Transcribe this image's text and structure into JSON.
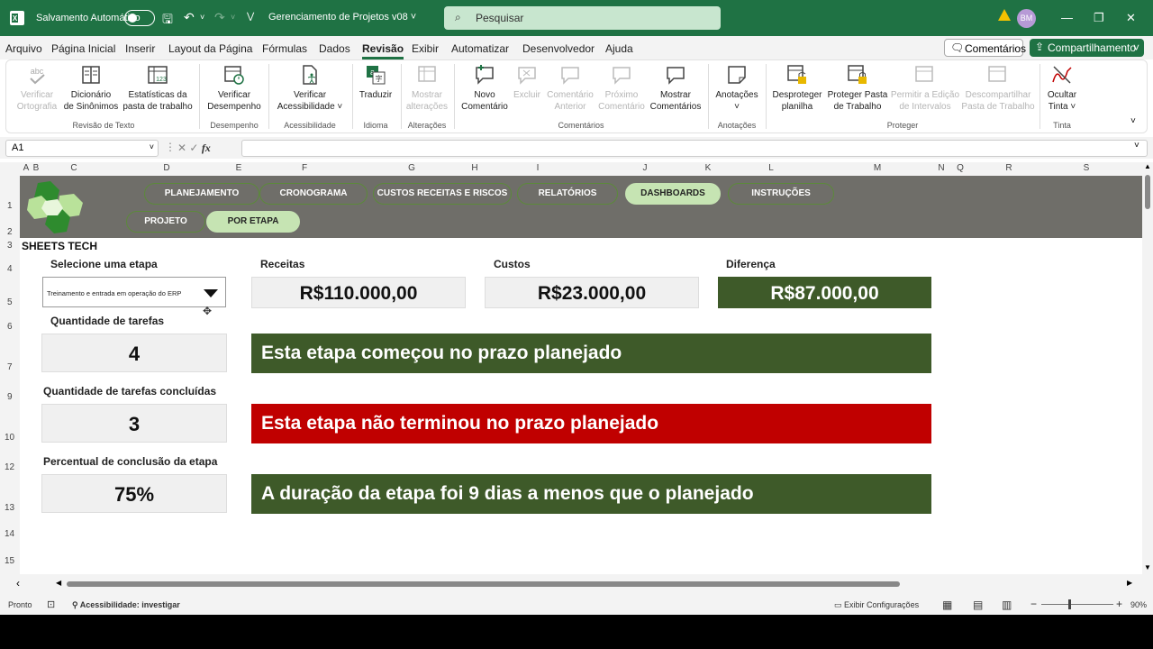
{
  "titlebar": {
    "autosave_label": "Salvamento Automático",
    "doc_title": "Gerenciamento de Projetos v08",
    "search_placeholder": "Pesquisar",
    "user_initials": "BM"
  },
  "menu": [
    "Arquivo",
    "Página Inicial",
    "Inserir",
    "Layout da Página",
    "Fórmulas",
    "Dados",
    "Revisão",
    "Exibir",
    "Automatizar",
    "Desenvolvedor",
    "Ajuda"
  ],
  "menu_active": "Revisão",
  "top_right": {
    "comments": "Comentários",
    "share": "Compartilhamento"
  },
  "ribbon": {
    "buttons": [
      {
        "l1": "Verificar",
        "l2": "Ortografia",
        "ico": "spell-check-icon"
      },
      {
        "l1": "Dicionário",
        "l2": "de Sinônimos",
        "ico": "thesaurus-icon"
      },
      {
        "l1": "Estatísticas da",
        "l2": "pasta de trabalho",
        "ico": "statistics-icon"
      },
      {
        "l1": "Verificar",
        "l2": "Desempenho",
        "ico": "performance-icon"
      },
      {
        "l1": "Verificar",
        "l2": "Acessibilidade ˅",
        "ico": "accessibility-icon"
      },
      {
        "l1": "Traduzir",
        "l2": "",
        "ico": "translate-icon"
      },
      {
        "l1": "Mostrar",
        "l2": "alterações",
        "ico": "changes-icon"
      },
      {
        "l1": "Novo",
        "l2": "Comentário",
        "ico": "new-comment-icon"
      },
      {
        "l1": "Excluir",
        "l2": "",
        "ico": "delete-comment-icon"
      },
      {
        "l1": "Comentário",
        "l2": "Anterior",
        "ico": "prev-comment-icon"
      },
      {
        "l1": "Próximo",
        "l2": "Comentário",
        "ico": "next-comment-icon"
      },
      {
        "l1": "Mostrar",
        "l2": "Comentários",
        "ico": "show-comments-icon"
      },
      {
        "l1": "Anotações",
        "l2": "˅",
        "ico": "notes-icon"
      },
      {
        "l1": "Desproteger",
        "l2": "planilha",
        "ico": "unprotect-sheet-icon"
      },
      {
        "l1": "Proteger Pasta",
        "l2": "de Trabalho",
        "ico": "protect-workbook-icon"
      },
      {
        "l1": "Permitir a Edição",
        "l2": "de Intervalos",
        "ico": "allow-edit-icon"
      },
      {
        "l1": "Descompartilhar",
        "l2": "Pasta de Trabalho",
        "ico": "unshare-icon"
      },
      {
        "l1": "Ocultar",
        "l2": "Tinta ˅",
        "ico": "ink-icon"
      }
    ],
    "groups": [
      "Revisão de Texto",
      "Desempenho",
      "Acessibilidade",
      "Idioma",
      "Alterações",
      "Comentários",
      "Anotações",
      "Proteger",
      "Tinta"
    ]
  },
  "formula": {
    "namebox": "A1",
    "fx": "fx"
  },
  "columns": [
    "A",
    "B",
    "C",
    "D",
    "E",
    "F",
    "G",
    "H",
    "I",
    "J",
    "K",
    "L",
    "M",
    "N",
    "Q",
    "R",
    "S"
  ],
  "rows": [
    "1",
    "2",
    "3",
    "4",
    "5",
    "6",
    "7",
    "9",
    "10",
    "12",
    "13",
    "14",
    "15"
  ],
  "nav": {
    "row1": [
      "PLANEJAMENTO",
      "CRONOGRAMA",
      "CUSTOS RECEITAS E RISCOS",
      "RELATÓRIOS",
      "DASHBOARDS",
      "INSTRUÇÕES"
    ],
    "row2": [
      "PROJETO",
      "POR ETAPA"
    ]
  },
  "brand": "SHEETS TECH",
  "dashboard": {
    "select_label": "Selecione uma etapa",
    "select_value": "Treinamento e entrada em operação do ERP",
    "receitas_label": "Receitas",
    "receitas_value": "R$110.000,00",
    "custos_label": "Custos",
    "custos_value": "R$23.000,00",
    "diferenca_label": "Diferença",
    "diferenca_value": "R$87.000,00",
    "tasks_label": "Quantidade de tarefas",
    "tasks_value": "4",
    "done_label": "Quantidade de tarefas concluídas",
    "done_value": "3",
    "pct_label": "Percentual de conclusão da etapa",
    "pct_value": "75%",
    "msg_start": "Esta etapa começou no prazo planejado",
    "msg_end": "Esta etapa não terminou no prazo planejado",
    "msg_duration": "A duração da etapa foi 9 dias a menos que o planejado"
  },
  "colors": {
    "excel_green": "#1f7244",
    "dark_green": "#3e5a29",
    "red": "#c00000",
    "banner_gray": "#6f6e69",
    "nav_active": "#c6e4b3"
  },
  "status": {
    "ready": "Pronto",
    "accessibility": "Acessibilidade: investigar",
    "display_settings": "Exibir Configurações",
    "zoom": "90%"
  }
}
